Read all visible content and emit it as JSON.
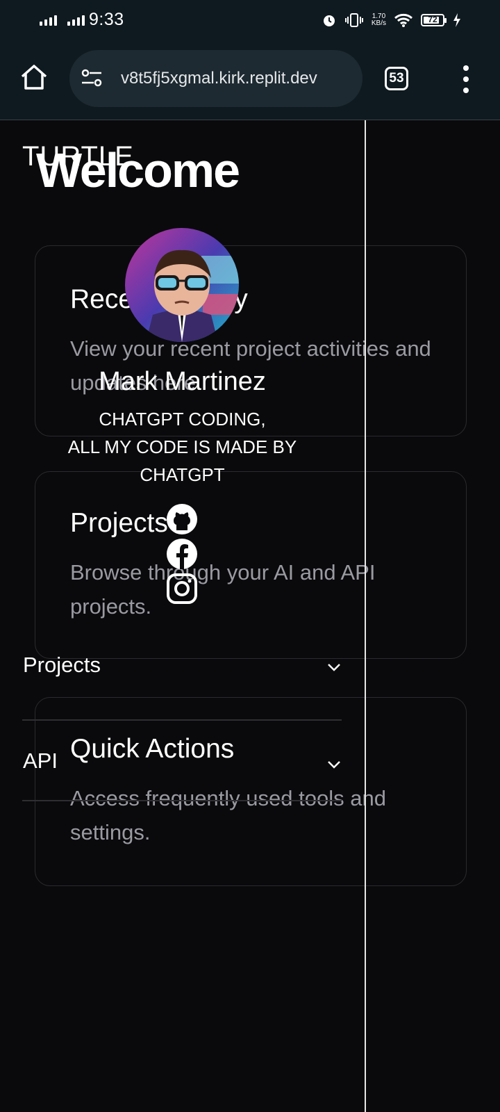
{
  "status_bar": {
    "time": "9:33",
    "net_speed_value": "1.70",
    "net_speed_unit": "KB/s",
    "battery": "72"
  },
  "browser": {
    "url": "v8t5fj5xgmal.kirk.replit.dev",
    "tab_count": "53"
  },
  "page": {
    "brand": "TURTLE",
    "welcome": "Welcome",
    "cards": [
      {
        "title": "Recent Activity",
        "description": "View your recent project activities and updates here."
      },
      {
        "title": "Projects",
        "description": "Browse through your AI and API projects."
      },
      {
        "title": "Quick Actions",
        "description": "Access frequently used tools and settings."
      }
    ]
  },
  "sidebar": {
    "profile": {
      "name": "Mark Martinez",
      "bio_lines": [
        "CHATGPT CODING,",
        "ALL MY CODE IS MADE BY",
        "CHATGPT"
      ]
    },
    "social_icons": [
      "github-icon",
      "facebook-icon",
      "instagram-icon"
    ],
    "menu": [
      {
        "label": "Projects"
      },
      {
        "label": "API"
      }
    ]
  },
  "colors": {
    "background": "#0a0a0c",
    "browser_chrome": "#0f1a20",
    "url_pill": "#1d2a31",
    "card_border": "#2b2b30",
    "muted_text": "#9a9aa2"
  }
}
